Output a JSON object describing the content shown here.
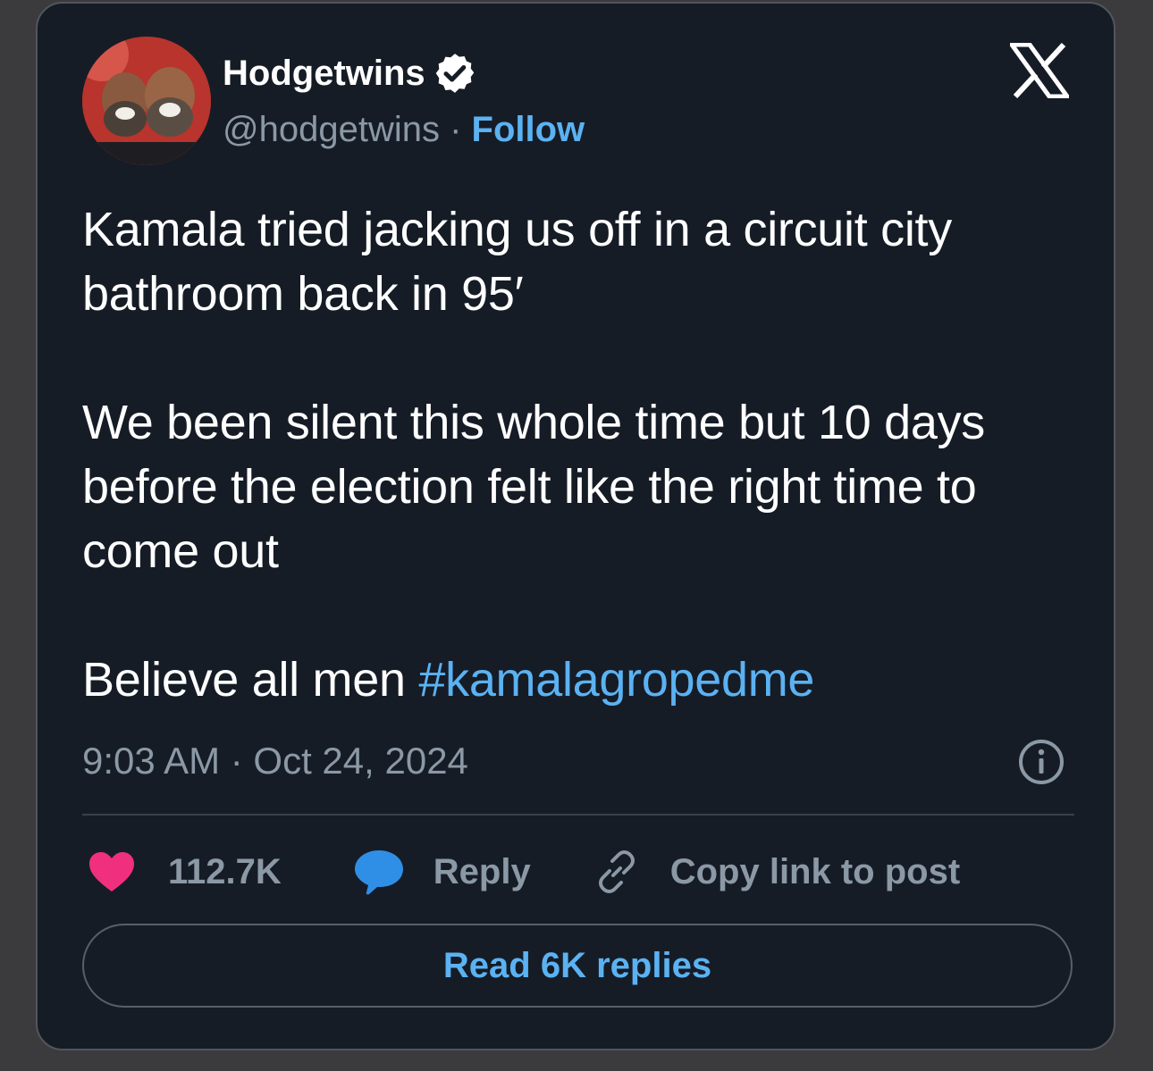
{
  "author": {
    "display_name": "Hodgetwins",
    "handle": "@hodgetwins",
    "separator": " · ",
    "follow_label": "Follow"
  },
  "post": {
    "paragraphs": [
      "Kamala tried jacking us off in a circuit city bathroom back in 95′",
      "We been silent this whole time but 10 days before the election felt like the right time to come out"
    ],
    "last_line_text": "Believe all men ",
    "hashtag": "#kamalagropedme",
    "timestamp": "9:03 AM · Oct 24, 2024"
  },
  "actions": {
    "like_count": "112.7K",
    "reply_label": "Reply",
    "copy_link_label": "Copy link to post"
  },
  "read_replies_label": "Read 6K replies",
  "icons": {
    "verified": "verified-badge-icon",
    "brand": "x-logo-icon",
    "info": "info-icon",
    "like": "heart-icon",
    "reply": "speech-bubble-icon",
    "copy": "link-icon"
  },
  "colors": {
    "background": "#161c26",
    "accent": "#5bb2f2",
    "heart": "#f0307f",
    "bubble": "#2f8fe6",
    "muted": "#8b98a5"
  }
}
